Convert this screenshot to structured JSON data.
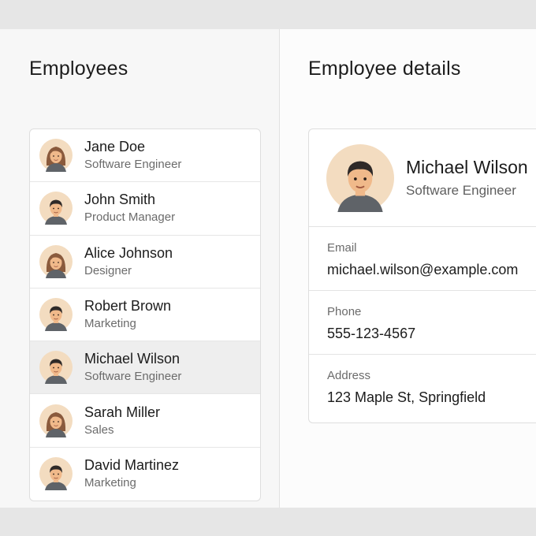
{
  "employees_panel": {
    "title": "Employees",
    "items": [
      {
        "name": "Jane Doe",
        "role": "Software Engineer",
        "avatar": "female-avatar-icon",
        "selected": false
      },
      {
        "name": "John Smith",
        "role": "Product Manager",
        "avatar": "male-avatar-icon",
        "selected": false
      },
      {
        "name": "Alice Johnson",
        "role": "Designer",
        "avatar": "female-avatar-icon",
        "selected": false
      },
      {
        "name": "Robert Brown",
        "role": "Marketing",
        "avatar": "male-avatar-icon",
        "selected": false
      },
      {
        "name": "Michael Wilson",
        "role": "Software Engineer",
        "avatar": "male-avatar-icon",
        "selected": true
      },
      {
        "name": "Sarah Miller",
        "role": "Sales",
        "avatar": "female-avatar-icon",
        "selected": false
      },
      {
        "name": "David Martinez",
        "role": "Marketing",
        "avatar": "male-avatar-icon",
        "selected": false
      }
    ]
  },
  "details_panel": {
    "title": "Employee details",
    "name": "Michael Wilson",
    "role": "Software Engineer",
    "avatar": "male-avatar-icon",
    "fields": [
      {
        "label": "Email",
        "value": "michael.wilson@example.com"
      },
      {
        "label": "Phone",
        "value": "555-123-4567"
      },
      {
        "label": "Address",
        "value": "123 Maple  St, Springfield"
      }
    ]
  },
  "colors": {
    "background": "#e6e6e6",
    "pane_left": "#f7f7f7",
    "pane_right": "#fcfcfc",
    "selected_row": "#eeeeee",
    "avatar_bg": "#f3dcc0",
    "skin": "#f0b98a",
    "hair_female": "#8a5a3c",
    "hair_male": "#2f2a28",
    "shirt": "#5f6368"
  }
}
